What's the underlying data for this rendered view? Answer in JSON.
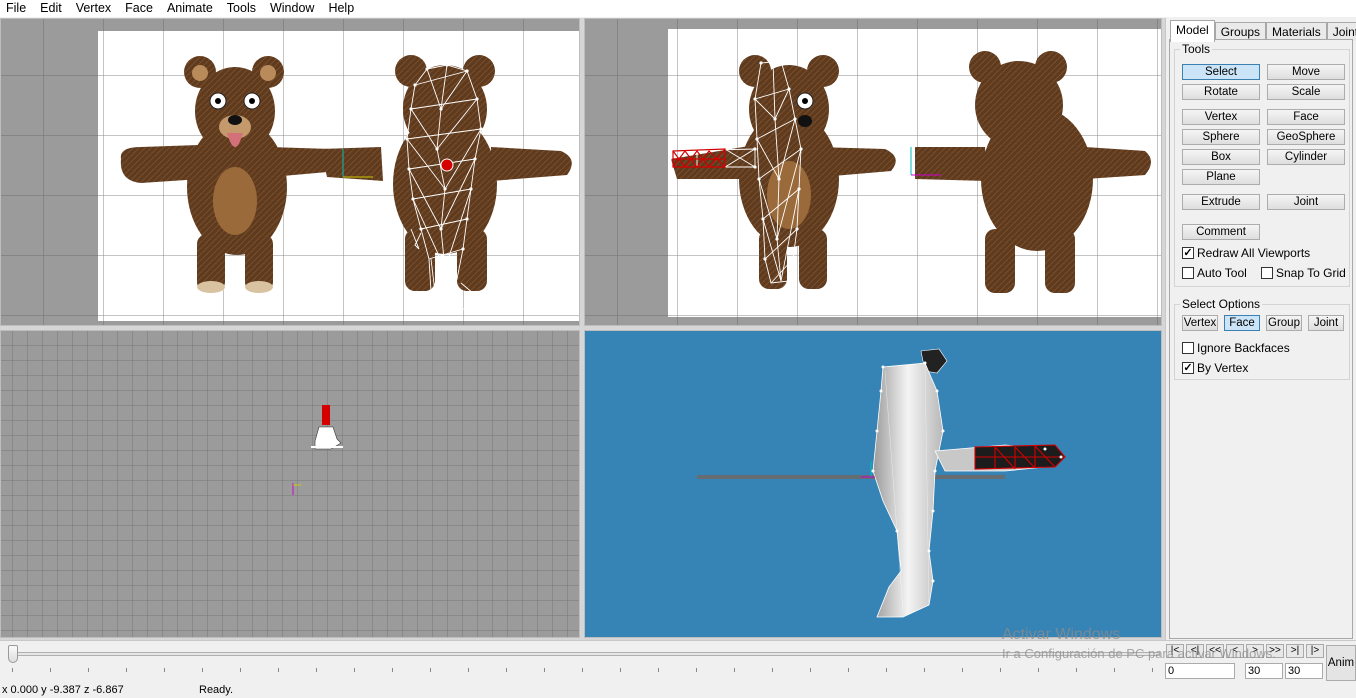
{
  "menu": [
    "File",
    "Edit",
    "Vertex",
    "Face",
    "Animate",
    "Tools",
    "Window",
    "Help"
  ],
  "tabs": [
    "Model",
    "Groups",
    "Materials",
    "Joints"
  ],
  "tools": {
    "title": "Tools",
    "buttons": [
      "Select",
      "Move",
      "Rotate",
      "Scale",
      "Vertex",
      "Face",
      "Sphere",
      "GeoSphere",
      "Box",
      "Cylinder",
      "Plane",
      "Extrude",
      "Joint",
      "Comment"
    ],
    "checks": {
      "redraw": "Redraw All Viewports",
      "auto_tool": "Auto Tool",
      "snap": "Snap To Grid"
    }
  },
  "select_options": {
    "title": "Select Options",
    "buttons": [
      "Vertex",
      "Face",
      "Group",
      "Joint"
    ],
    "ignore_backfaces": "Ignore Backfaces",
    "by_vertex": "By Vertex"
  },
  "state": {
    "active_tool": "Select",
    "active_select_mode": "Face",
    "redraw_all": true,
    "auto_tool": false,
    "snap_to_grid": false,
    "ignore_backfaces": false,
    "by_vertex": true
  },
  "animation": {
    "buttons": [
      "|<",
      "<|",
      "<<",
      "<",
      ">",
      ">>",
      ">|",
      "|>"
    ],
    "start_frame": "0",
    "frames_a": "30",
    "frames_b": "30",
    "anim_label": "Anim"
  },
  "watermark": {
    "line1": "Activar Windows",
    "line2": "Ir a Configuración de PC para activar Windows."
  },
  "status": {
    "coords": "x 0.000 y -9.387 z -6.867",
    "message": "Ready."
  },
  "icons": {
    "check": "checkmark-icon"
  },
  "colors": {
    "viewport_bg": "#9b9b9b",
    "perspective_bg": "#3683b6",
    "selected_face": "#d40000",
    "bear_brown": "#5e3a1e"
  }
}
